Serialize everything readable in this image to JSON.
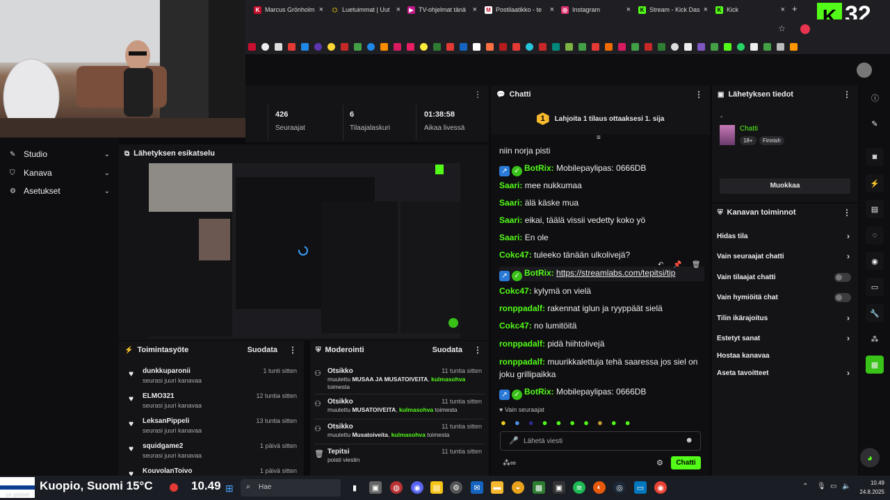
{
  "browser": {
    "tabs": [
      {
        "label": "Marcus Grönholm",
        "icon": "K",
        "color": "#c8102e"
      },
      {
        "label": "Luetuimmat | Uut",
        "icon": "⬡",
        "color": "#f5c518"
      },
      {
        "label": "TV-ohjelmat tänä",
        "icon": "▶",
        "color": "#c4198a"
      },
      {
        "label": "Postilaatikko - te",
        "icon": "M",
        "color": "#ffffff"
      },
      {
        "label": "Instagram",
        "icon": "◎",
        "color": "#e1306c"
      },
      {
        "label": "Stream - Kick Das",
        "icon": "K",
        "color": "#53fc18"
      },
      {
        "label": "Kick",
        "icon": "K",
        "color": "#53fc18"
      }
    ],
    "new_tab": "+",
    "overlay_number": "32"
  },
  "sidebar": {
    "items": [
      {
        "label": "Studio",
        "icon": "✎"
      },
      {
        "label": "Kanava",
        "icon": "⛉"
      },
      {
        "label": "Asetukset",
        "icon": "⚙"
      }
    ]
  },
  "stats": [
    {
      "value": "426",
      "label": "Seuraajat"
    },
    {
      "value": "6",
      "label": "Tilaajalaskuri"
    },
    {
      "value": "01:38:58",
      "label": "Aikaa livessä"
    }
  ],
  "preview": {
    "title": "Lähetyksen esikatselu"
  },
  "activity": {
    "title": "Toimintasyöte",
    "filter": "Suodata",
    "items": [
      {
        "name": "dunkkuparonii",
        "sub": "seurasi juuri kanavaa",
        "time": "1 tunti sitten"
      },
      {
        "name": "ELMO321",
        "sub": "seurasi juuri kanavaa",
        "time": "12 tuntia sitten"
      },
      {
        "name": "LeksanPippeli",
        "sub": "seurasi juuri kanavaa",
        "time": "13 tuntia sitten"
      },
      {
        "name": "squidgame2",
        "sub": "seurasi juuri kanavaa",
        "time": "1 päivä sitten"
      },
      {
        "name": "KouvolanToivo",
        "sub": "",
        "time": "1 päivä sitten"
      }
    ]
  },
  "moderation": {
    "title": "Moderointi",
    "filter": "Suodata",
    "items": [
      {
        "name": "Otsikko",
        "time": "11 tuntia sitten",
        "pre": "muutettu",
        "old": "MUSAA JA MUSATOIVEITA",
        "mid": ",",
        "cat": "kulmasohva",
        "post": "toimesta"
      },
      {
        "name": "Otsikko",
        "time": "11 tuntia sitten",
        "pre": "muutettu",
        "old": "MUSATOIVEITA",
        "mid": ",",
        "cat": "kulmasohva",
        "post": "toimesta"
      },
      {
        "name": "Otsikko",
        "time": "11 tuntia sitten",
        "pre": "muutettu",
        "old": "Musatoiveita",
        "mid": ",",
        "cat": "kulmasohva",
        "post": "toimesta"
      },
      {
        "name": "Tepitsi",
        "time": "11 tuntia sitten",
        "pre": "poisti viestin",
        "old": "",
        "mid": "",
        "cat": "",
        "post": ""
      }
    ]
  },
  "chat": {
    "title": "Chatti",
    "gift_banner": "Lahjoita 1 tilaus ottaaksesi 1. sija",
    "gift_rank": "1",
    "partial_line": "niin norja pisti",
    "messages": [
      {
        "user": "BotRix",
        "text": "Mobilepaylipas: 0666DB",
        "bot": true,
        "link": false
      },
      {
        "user": "Saari",
        "text": "mee nukkumaa"
      },
      {
        "user": "Saari",
        "text": "älä käske mua"
      },
      {
        "user": "Saari",
        "text": "eikai, täälä vissii vedetty koko yö"
      },
      {
        "user": "Saari",
        "text": "En ole"
      },
      {
        "user": "Cokc47",
        "text": "tuleeko tänään ulkolivejä?"
      },
      {
        "user": "BotRix",
        "text": "https://streamlabs.com/tepitsi/tip",
        "bot": true,
        "link": true
      },
      {
        "user": "Cokc47",
        "text": "kylymä on vielä"
      },
      {
        "user": "ronppadalf",
        "text": "rakennat iglun ja ryyppäät sielä"
      },
      {
        "user": "Cokc47",
        "text": "no lumitöitä"
      },
      {
        "user": "ronppadalf",
        "text": "pidä hiihtolivejä"
      },
      {
        "user": "ronppadalf",
        "text": "muurikkalettuja tehä saaressa jos siel on joku grillipaikka"
      },
      {
        "user": "BotRix",
        "text": "Mobilepaylipas: 0666DB",
        "bot": true
      }
    ],
    "mode_note": "Vain seuraajat",
    "input_placeholder": "Lähetä viesti",
    "send_label": "Chatti"
  },
  "stream_info": {
    "title": "Lähetyksen tiedot",
    "dash": "-",
    "category": "Chatti",
    "tags": [
      "18+",
      "Finnish"
    ],
    "edit_label": "Muokkaa"
  },
  "channel_actions": {
    "title": "Kanavan toiminnot",
    "rows": [
      {
        "label": "Hidas tila",
        "kind": "chevron"
      },
      {
        "label": "Vain seuraajat chatti",
        "kind": "chevron"
      },
      {
        "label": "Vain tilaajat chatti",
        "kind": "toggle"
      },
      {
        "label": "Vain hymiöitä chat",
        "kind": "toggle"
      },
      {
        "label": "Tilin ikärajoitus",
        "kind": "chevron"
      },
      {
        "label": "Estetyt sanat",
        "kind": "chevron"
      },
      {
        "label": "Hostaa kanavaa",
        "kind": "none"
      },
      {
        "label": "Aseta tavoitteet",
        "kind": "chevron"
      }
    ]
  },
  "taskbar": {
    "weather": "Kuopio, Suomi 15°C",
    "clock_overlay": "10.49",
    "search_placeholder": "Hae",
    "time": "10.49",
    "date": "24.8.2025",
    "sub_text": "un pisteet"
  },
  "colors": {
    "accent": "#53fc18",
    "panel": "#141417",
    "bg": "#0b0b0d"
  }
}
